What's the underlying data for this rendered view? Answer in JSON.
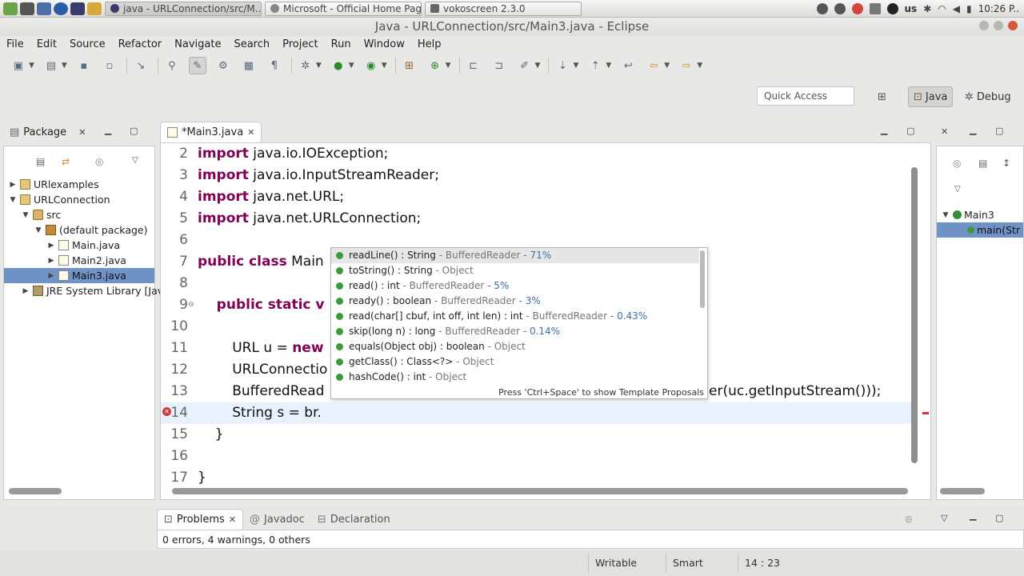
{
  "taskbar": {
    "tasks": [
      "java - URLConnection/src/M...",
      "Microsoft - Official Home Page",
      "vokoscreen 2.3.0"
    ],
    "tray": {
      "lang": "us",
      "clock": "10:26 P.."
    }
  },
  "window": {
    "title": "Java - URLConnection/src/Main3.java - Eclipse"
  },
  "menu": [
    "File",
    "Edit",
    "Source",
    "Refactor",
    "Navigate",
    "Search",
    "Project",
    "Run",
    "Window",
    "Help"
  ],
  "quick_access": {
    "placeholder": "Quick Access"
  },
  "perspectives": {
    "java": "Java",
    "debug": "Debug"
  },
  "package_explorer": {
    "title": "Package",
    "items": [
      {
        "label": "URlexamples"
      },
      {
        "label": "URLConnection"
      },
      {
        "label": "src"
      },
      {
        "label": "(default package)"
      },
      {
        "label": "Main.java"
      },
      {
        "label": "Main2.java"
      },
      {
        "label": "Main3.java"
      },
      {
        "label": "JRE System Library [Jav"
      }
    ]
  },
  "editor": {
    "tab": "*Main3.java",
    "lines": [
      {
        "n": "2",
        "kw": "import",
        "text": " java.io.IOException;"
      },
      {
        "n": "3",
        "kw": "import",
        "text": " java.io.InputStreamReader;"
      },
      {
        "n": "4",
        "kw": "import",
        "text": " java.net.URL;"
      },
      {
        "n": "5",
        "kw": "import",
        "text": " java.net.URLConnection;"
      },
      {
        "n": "6",
        "kw": "",
        "text": ""
      },
      {
        "n": "7",
        "kw": "public class",
        "text": " Main"
      },
      {
        "n": "8",
        "kw": "",
        "text": ""
      },
      {
        "n": "9",
        "kw": "    public static v",
        "text": ""
      },
      {
        "n": "10",
        "kw": "",
        "text": ""
      },
      {
        "n": "11",
        "kw": "",
        "text": "        URL u = ",
        "kw2": "new"
      },
      {
        "n": "12",
        "kw": "",
        "text": "        URLConnectio"
      },
      {
        "n": "13",
        "kw": "",
        "text": "        BufferedRead",
        "tail": "er(uc.getInputStream()));"
      },
      {
        "n": "14",
        "kw": "",
        "text": "        String s = br."
      },
      {
        "n": "15",
        "kw": "",
        "text": "    }"
      },
      {
        "n": "16",
        "kw": "",
        "text": ""
      },
      {
        "n": "17",
        "kw": "",
        "text": "}"
      }
    ]
  },
  "autocomplete": {
    "items": [
      {
        "name": "readLine() : String",
        "type": " - BufferedReader",
        "pct": " - 71%"
      },
      {
        "name": "toString() : String",
        "type": " - Object",
        "pct": ""
      },
      {
        "name": "read() : int",
        "type": " - BufferedReader",
        "pct": " - 5%"
      },
      {
        "name": "ready() : boolean",
        "type": " - BufferedReader",
        "pct": " - 3%"
      },
      {
        "name": "read(char[] cbuf, int off, int len) : int",
        "type": " - BufferedReader",
        "pct": " - 0.43%"
      },
      {
        "name": "skip(long n) : long",
        "type": " - BufferedReader",
        "pct": " - 0.14%"
      },
      {
        "name": "equals(Object obj) : boolean",
        "type": " - Object",
        "pct": ""
      },
      {
        "name": "getClass() : Class<?>",
        "type": " - Object",
        "pct": ""
      },
      {
        "name": "hashCode() : int",
        "type": " - Object",
        "pct": ""
      }
    ],
    "footer": "Press 'Ctrl+Space' to show Template Proposals"
  },
  "outline": {
    "items": [
      "Main3",
      "main(Str"
    ]
  },
  "bottom": {
    "tabs": [
      "Problems",
      "Javadoc",
      "Declaration"
    ],
    "summary": "0 errors, 4 warnings, 0 others"
  },
  "status": {
    "writable": "Writable",
    "insert": "Smart Insert",
    "position": "14 : 23"
  },
  "colors": {
    "keyword": "#7f0055",
    "selection": "#6f93c7"
  }
}
